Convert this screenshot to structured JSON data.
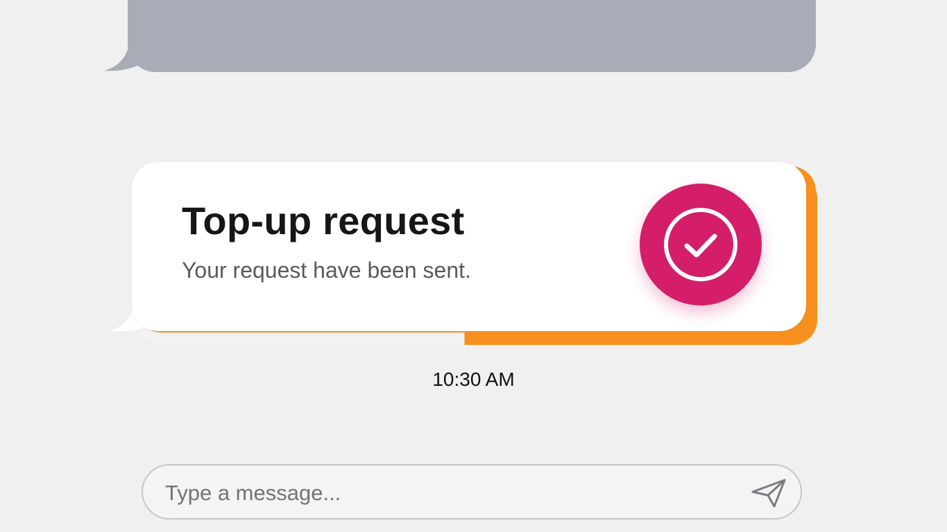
{
  "messages": {
    "incoming_grey": {
      "color": "#a9acb6"
    },
    "notification": {
      "title": "Top-up request",
      "subtitle": "Your request have been sent.",
      "status_icon": "check-circle-icon",
      "accent_color": "#f7901e",
      "badge_color": "#d41e69"
    },
    "timestamp": "10:30 AM"
  },
  "composer": {
    "placeholder": "Type a message...",
    "value": "",
    "send_icon": "send-icon"
  }
}
